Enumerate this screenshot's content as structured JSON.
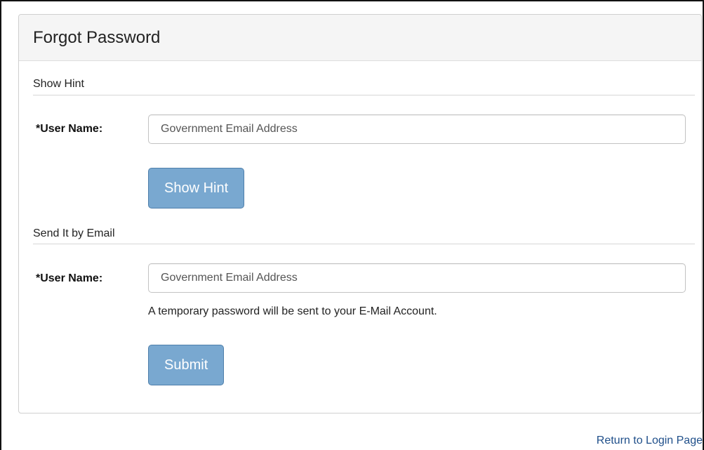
{
  "page": {
    "title": "Forgot Password"
  },
  "show_hint_section": {
    "heading": "Show Hint",
    "username_label": "*User Name:",
    "username_placeholder": "Government Email Address",
    "username_value": "",
    "button_label": "Show Hint"
  },
  "email_section": {
    "heading": "Send It by Email",
    "username_label": "*User Name:",
    "username_placeholder": "Government Email Address",
    "username_value": "",
    "help_text": "A temporary password will be sent to your E-Mail Account.",
    "button_label": "Submit"
  },
  "footer": {
    "return_link_label": "Return to Login Page"
  },
  "colors": {
    "button_background": "#79a8d0",
    "button_border": "#4f7fab",
    "link": "#1f4f8a",
    "heading_background": "#f5f5f5"
  }
}
